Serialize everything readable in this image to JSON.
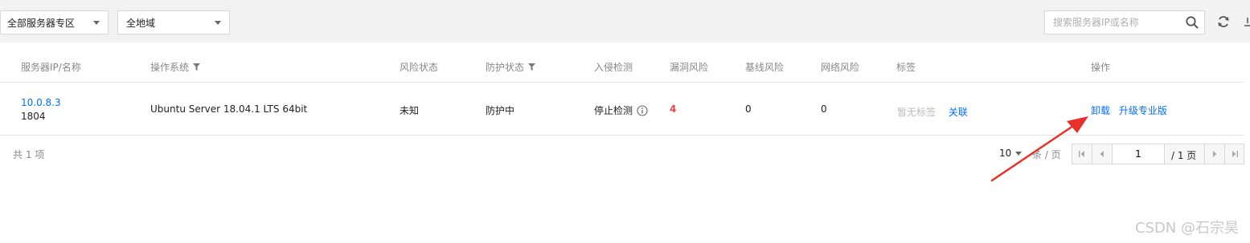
{
  "toolbar": {
    "zone_select": "全部服务器专区",
    "region_select": "全地域",
    "search_placeholder": "搜索服务器IP或名称"
  },
  "table": {
    "headers": {
      "server": "服务器IP/名称",
      "os": "操作系统",
      "risk_status": "风险状态",
      "protect_status": "防护状态",
      "intrusion": "入侵检测",
      "vuln_risk": "漏洞风险",
      "baseline_risk": "基线风险",
      "network_risk": "网络风险",
      "tags": "标签",
      "actions": "操作"
    },
    "rows": [
      {
        "ip": "10.0.8.3",
        "name": "1804",
        "os": "Ubuntu Server 18.04.1 LTS 64bit",
        "risk_status": "未知",
        "protect_status": "防护中",
        "intrusion": "停止检测",
        "vuln_risk": "4",
        "baseline_risk": "0",
        "network_risk": "0",
        "tags": "暂无标签",
        "tag_link": "关联",
        "action_uninstall": "卸载",
        "action_upgrade": "升级专业版"
      }
    ]
  },
  "footer": {
    "total": "共 1 项",
    "page_size": "10",
    "per_page": "条 / 页",
    "current_page": "1",
    "total_pages": "/ 1 页"
  },
  "watermark": "CSDN @石宗昊",
  "colors": {
    "link": "#006eff",
    "vuln": "#e54545",
    "annotation_arrow": "#e8312a"
  }
}
